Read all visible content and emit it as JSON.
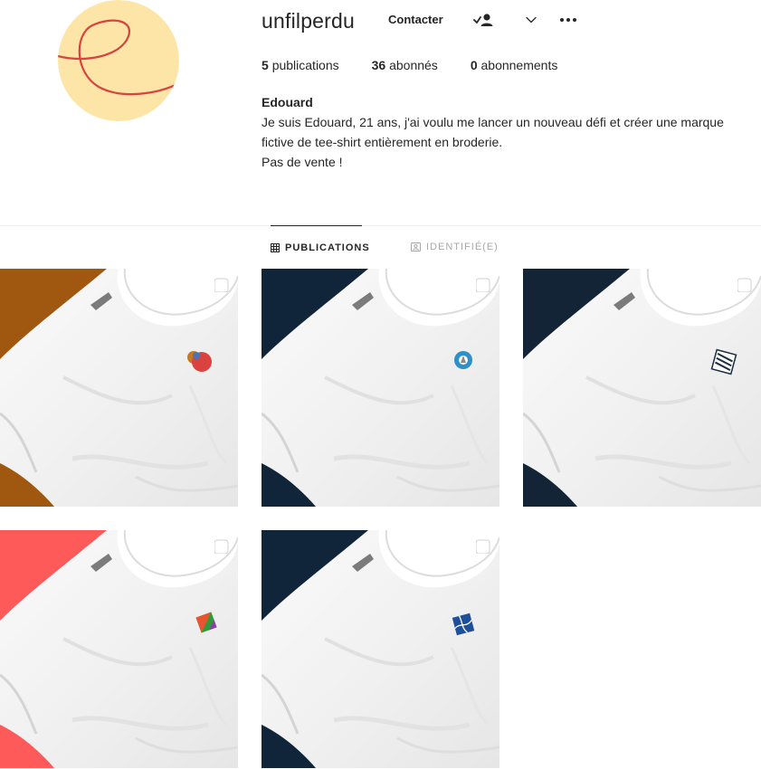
{
  "profile": {
    "username": "unfilperdu",
    "contact_label": "Contacter",
    "follow_icon": "person-check-icon",
    "chevron_icon": "chevron-down-icon",
    "more_icon": "more-options-icon",
    "avatar_colors": {
      "bg": "#fce5a6",
      "thread": "#d9423f"
    }
  },
  "stats": {
    "posts": {
      "count": "5",
      "label": "publications"
    },
    "followers": {
      "count": "36",
      "label": "abonnés"
    },
    "following": {
      "count": "0",
      "label": "abonnements"
    }
  },
  "bio": {
    "name": "Edouard",
    "lines": [
      "Je suis Edouard, 21 ans, j'ai voulu me lancer un nouveau défi et créer une marque",
      "fictive de tee-shirt entièrement en broderie.",
      "Pas de vente !"
    ]
  },
  "tabs": [
    {
      "label": "PUBLICATIONS",
      "icon": "grid-icon",
      "active": true
    },
    {
      "label": "IDENTIFIÉ(E)",
      "icon": "tagged-icon",
      "active": false
    }
  ],
  "posts": [
    {
      "background": "#a0570f",
      "patch": "circles-patch",
      "multiple": true
    },
    {
      "background": "#10243a",
      "patch": "ring-patch",
      "multiple": true
    },
    {
      "background": "#122436",
      "patch": "stripes-patch",
      "multiple": true
    },
    {
      "background": "#ff5a5a",
      "patch": "colorful-diamond-patch",
      "multiple": true
    },
    {
      "background": "#10243a",
      "patch": "blue-diamond-patch",
      "multiple": true
    }
  ]
}
